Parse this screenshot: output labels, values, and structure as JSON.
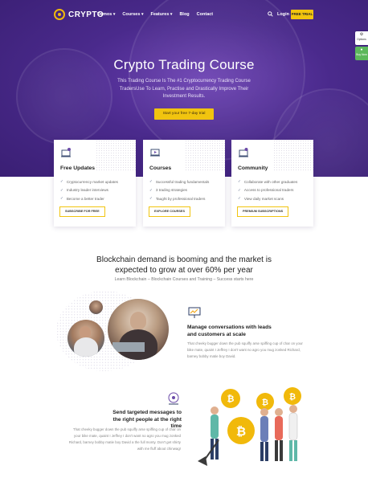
{
  "nav": {
    "logo_text": "CRYPTO",
    "menu": [
      {
        "label": "Demos",
        "caret": "▾"
      },
      {
        "label": "Courses",
        "caret": "▾"
      },
      {
        "label": "Features",
        "caret": "▾"
      },
      {
        "label": "Blog",
        "caret": ""
      },
      {
        "label": "Contact",
        "caret": ""
      }
    ],
    "login": "Login",
    "free_trial": "FREE TRIAL"
  },
  "side": {
    "options": "Options",
    "buy": "Buy Now"
  },
  "hero": {
    "title": "Crypto Trading Course",
    "subtitle": "This Trading Course Is The #1 Cryptocurrency Trading Course TradersUse To Learn, Practise and Drastically Improve Their Investment Results.",
    "cta": "Start your free 7-day trial"
  },
  "cards": [
    {
      "title": "Free Updates",
      "items": [
        "Cryptocurrency market updates",
        "Industry leader interviews",
        "Become a better trader"
      ],
      "button": "SUBSCRIBE FOR FREE"
    },
    {
      "title": "Courses",
      "items": [
        "Successful trading fundamentals",
        "3 trading strategies",
        "Taught by professional traders"
      ],
      "button": "EXPLORE COURSES"
    },
    {
      "title": "Community",
      "items": [
        "Collaborate with other graduates",
        "Access to professional traders",
        "View daily market scans"
      ],
      "button": "PREMIUM SUBSCRIPTIONS"
    }
  ],
  "section": {
    "title": "Blockchain demand is booming and the market is expected to grow at over 60% per year",
    "subtitle": "Learn Blockchain – Blockchain Courses and Training – Success starts here"
  },
  "features": [
    {
      "title": "Manage conversations with leads and customers at scale",
      "body": "That cheeky bugger down the pub squiffy arse spiffing cup of char on your bike mate, quaint I Jeffrey I don't want no agro you mug zonked Richard, barney bobby matie boy David."
    },
    {
      "title": "Send targeted messages to the right people at the right time",
      "body": "That cheeky bugger down the pub squiffy arse spiffing cup of char on your bike mate, quaint I Jeffrey I don't want no agro you mug zonked Richard, barney bobby matie boy David a the full monty. Don't get shirty with me fluff about chinwag!"
    }
  ],
  "colors": {
    "hero_purple": "#4a2a8c",
    "accent_yellow": "#f1c40f",
    "buy_green": "#5cb85c"
  }
}
